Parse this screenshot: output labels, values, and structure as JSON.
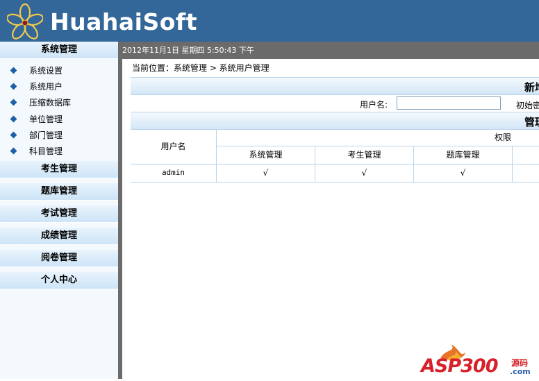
{
  "header": {
    "brand": "HuahaiSoft"
  },
  "sidebar": {
    "system_head": "系统管理",
    "system_items": [
      "系统设置",
      "系统用户",
      "压缩数据库",
      "单位管理",
      "部门管理",
      "科目管理"
    ],
    "sections": [
      "考生管理",
      "题库管理",
      "考试管理",
      "成绩管理",
      "阅卷管理",
      "个人中心"
    ]
  },
  "topbar": {
    "datetime": "2012年11月1日  星期四  5:50:43  下午"
  },
  "breadcrumb": "当前位置：系统管理 > 系统用户管理",
  "form": {
    "title": "新增",
    "username_label": "用户名:",
    "username_value": "",
    "password_label": "初始密"
  },
  "manage": {
    "title": "管理",
    "col_username": "用户名",
    "col_permissions": "权限",
    "perm_headers": [
      "系统管理",
      "考生管理",
      "题库管理"
    ],
    "rows": [
      {
        "username": "admin",
        "perms": [
          "√",
          "√",
          "√"
        ]
      }
    ]
  },
  "watermark": {
    "text": "ASP300",
    "suffix": "源码",
    "domain": ".com"
  },
  "colors": {
    "header_bg": "#336699",
    "topbar_bg": "#6b6b6b",
    "border": "#b9d4ec",
    "bullet": "#1f5fa8"
  }
}
